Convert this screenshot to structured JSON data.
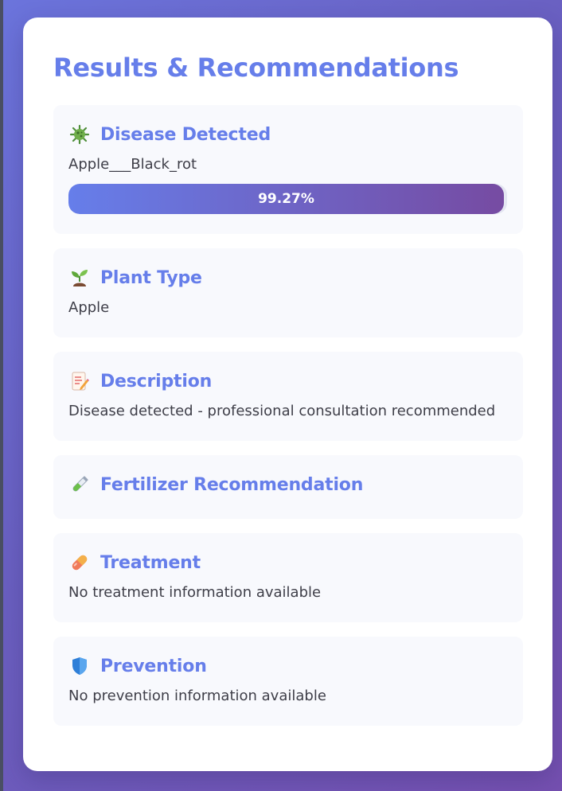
{
  "page": {
    "title": "Results & Recommendations"
  },
  "disease": {
    "title": "Disease Detected",
    "icon": "microbe-icon",
    "value": "Apple___Black_rot",
    "confidence_label": "99.27%",
    "confidence_fraction": 0.9927
  },
  "plant_type": {
    "title": "Plant Type",
    "icon": "seedling-icon",
    "value": "Apple"
  },
  "description": {
    "title": "Description",
    "icon": "memo-icon",
    "value": "Disease detected - professional consultation recommended"
  },
  "fertilizer": {
    "title": "Fertilizer Recommendation",
    "icon": "test-tube-icon",
    "value": ""
  },
  "treatment": {
    "title": "Treatment",
    "icon": "pill-icon",
    "value": "No treatment information available"
  },
  "prevention": {
    "title": "Prevention",
    "icon": "shield-icon",
    "value": "No prevention information available"
  },
  "colors": {
    "accent": "#667eea",
    "gradient_end": "#764ba2",
    "text": "#3e3e48",
    "section_bg": "#f8f9fd"
  }
}
